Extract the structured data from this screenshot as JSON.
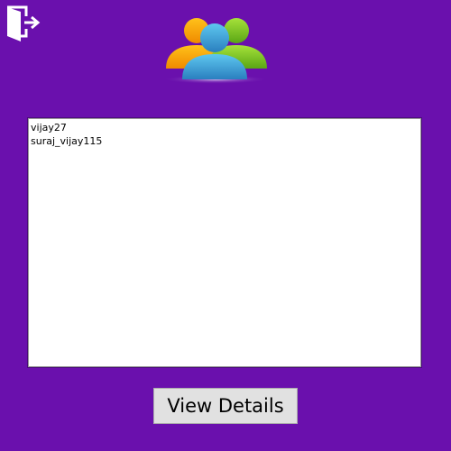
{
  "header": {
    "logout_icon": "logout-door-icon",
    "logo_icon": "users-group-icon"
  },
  "users_list": {
    "items": [
      {
        "label": "vijay27"
      },
      {
        "label": "suraj_vijay115"
      }
    ]
  },
  "actions": {
    "view_details_label": "View Details"
  },
  "colors": {
    "background": "#6a10ad",
    "list_background": "#ffffff",
    "button_background": "#e1e1e1"
  }
}
